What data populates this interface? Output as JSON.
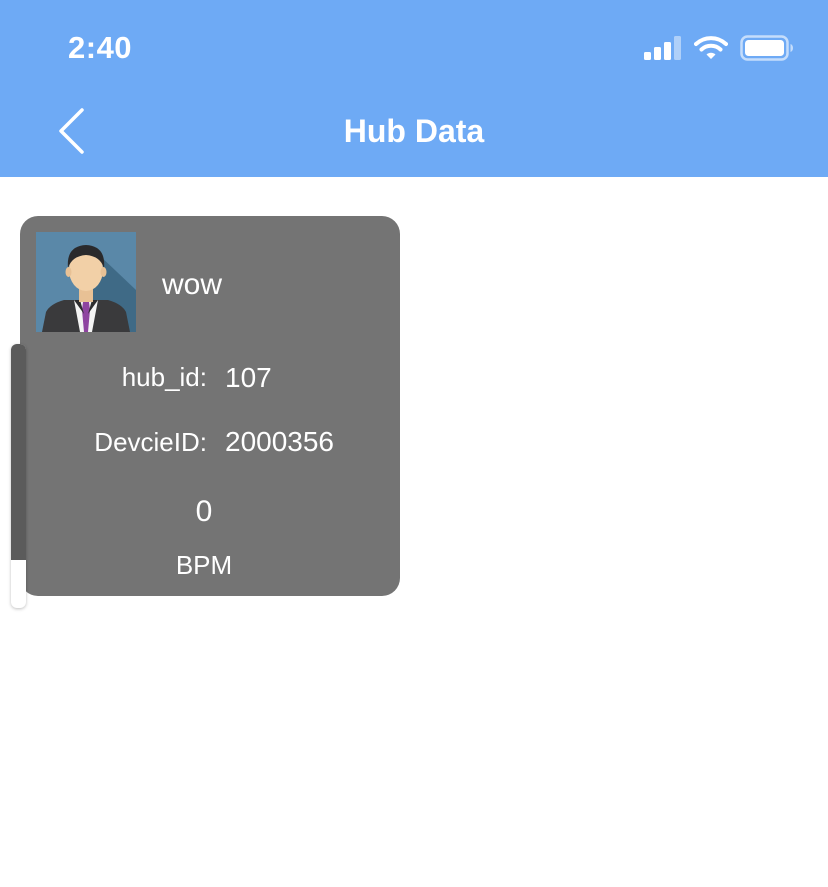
{
  "status_bar": {
    "time": "2:40",
    "icons": [
      "cellular-signal-icon",
      "wifi-icon",
      "battery-icon"
    ]
  },
  "nav": {
    "title": "Hub Data",
    "back_icon": "chevron-left-icon"
  },
  "card": {
    "name": "wow",
    "hub_id_label": "hub_id:",
    "hub_id_value": "107",
    "device_id_label": "DevcieID:",
    "device_id_value": "2000356",
    "bpm_value": "0",
    "bpm_unit": "BPM"
  },
  "level_indicator": {
    "fill_fraction": 0.82
  },
  "colors": {
    "header": "#6eaaf5",
    "card": "#747474",
    "text_on_dark": "#ffffff"
  }
}
